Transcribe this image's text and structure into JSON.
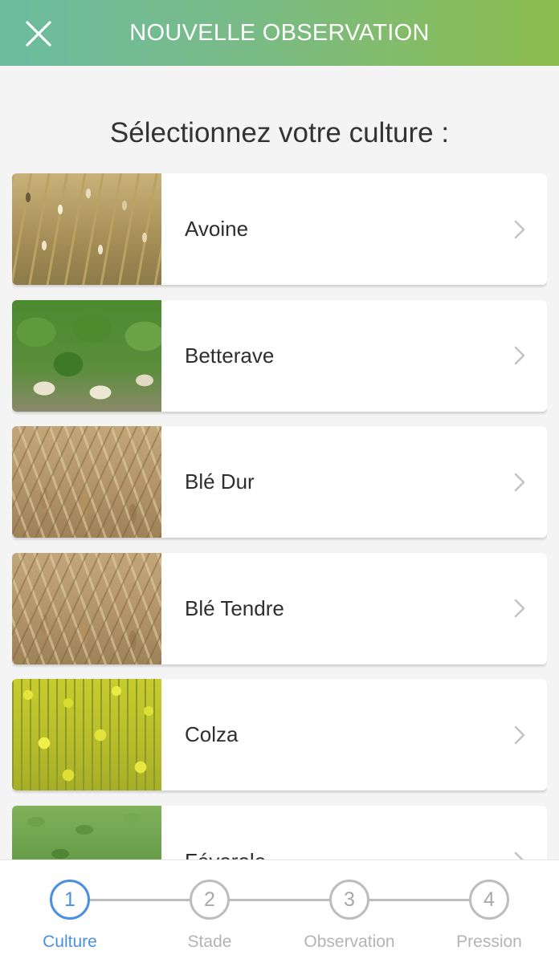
{
  "header": {
    "title": "NOUVELLE OBSERVATION",
    "close_icon": "close-icon"
  },
  "subtitle": "Sélectionnez votre culture :",
  "cultures": [
    {
      "label": "Avoine"
    },
    {
      "label": "Betterave"
    },
    {
      "label": "Blé Dur"
    },
    {
      "label": "Blé Tendre"
    },
    {
      "label": "Colza"
    },
    {
      "label": "Féverole"
    }
  ],
  "stepper": {
    "steps": [
      {
        "number": "1",
        "label": "Culture"
      },
      {
        "number": "2",
        "label": "Stade"
      },
      {
        "number": "3",
        "label": "Observation"
      },
      {
        "number": "4",
        "label": "Pression"
      }
    ],
    "active_step": "1"
  },
  "colors": {
    "header_gradient_start": "#6cbba0",
    "header_gradient_end": "#8cbc4c",
    "accent_active": "#4a90e2",
    "inactive": "#bdbdbd"
  }
}
